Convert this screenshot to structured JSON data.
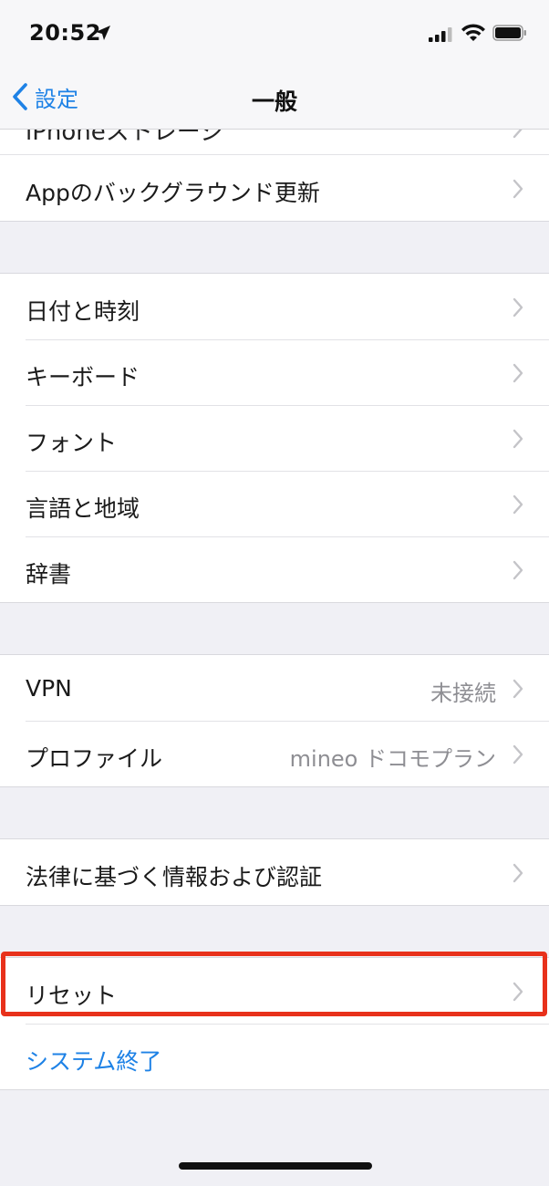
{
  "status_bar": {
    "time": "20:52",
    "icons": [
      "location-arrow-icon",
      "cellular-signal-icon",
      "wifi-icon",
      "battery-icon"
    ]
  },
  "nav": {
    "back_label": "設定",
    "title": "一般"
  },
  "list": {
    "cut_row_label": "iPhoneストレージ",
    "background_refresh": "Appのバックグラウンド更新",
    "date_time": "日付と時刻",
    "keyboard": "キーボード",
    "fonts": "フォント",
    "language_region": "言語と地域",
    "dictionary": "辞書",
    "vpn_label": "VPN",
    "vpn_value": "未接続",
    "profile_label": "プロファイル",
    "profile_value": "mineo ドコモプラン",
    "legal": "法律に基づく情報および認証",
    "reset": "リセット",
    "shutdown": "システム終了"
  },
  "colors": {
    "accent": "#1e82e6",
    "highlight": "#e8311b",
    "background": "#f0f0f5",
    "secondary_text": "#8e8e93"
  }
}
